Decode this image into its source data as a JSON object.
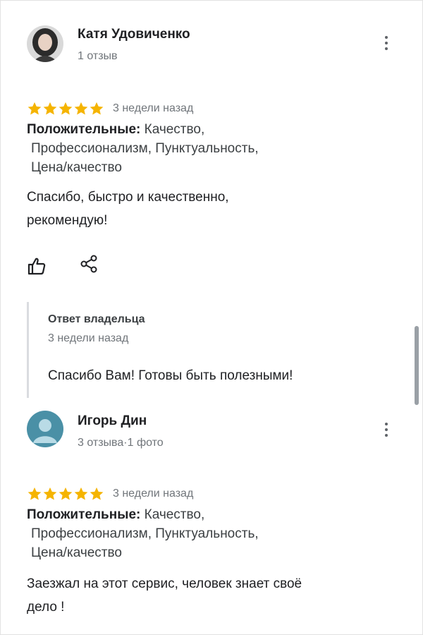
{
  "reviews": [
    {
      "author": "Катя Удовиченко",
      "meta": "1 отзыв",
      "rating": 5,
      "date": "3 недели назад",
      "attrs_label": "Положительные:",
      "attrs_line1": "Качество,",
      "attrs_line2": "Профессионализм, Пунктуальность,",
      "attrs_line3": "Цена/качество",
      "text_line1": "Спасибо, быстро и качественно,",
      "text_line2": "рекомендую!",
      "reply": {
        "title": "Ответ владельца",
        "date": "3 недели назад",
        "text": "Спасибо Вам! Готовы быть полезными!"
      }
    },
    {
      "author": "Игорь Дин",
      "meta": "3 отзыва·1 фото",
      "rating": 5,
      "date": "3 недели назад",
      "attrs_label": "Положительные:",
      "attrs_line1": "Качество,",
      "attrs_line2": "Профессионализм, Пунктуальность,",
      "attrs_line3": "Цена/качество",
      "text_line1": "Заезжал на этот сервис, человек знает своё",
      "text_line2": "дело !"
    }
  ],
  "icons": {
    "star": "star-icon",
    "like": "thumbs-up-icon",
    "share": "share-icon",
    "more": "more-vert-icon"
  },
  "colors": {
    "star": "#f5b400",
    "avatar_default": "#4a90a6"
  }
}
